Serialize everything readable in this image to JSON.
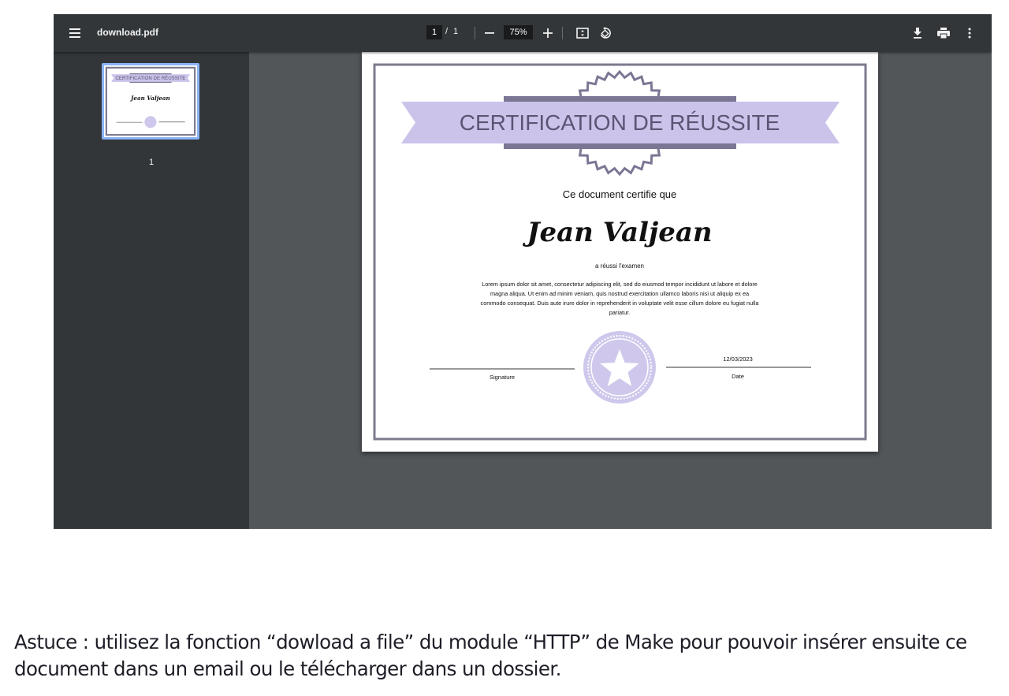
{
  "viewer": {
    "file_name": "download.pdf",
    "current_page": "1",
    "page_separator": "/",
    "total_pages": "1",
    "zoom": "75%",
    "thumbnail_label": "1",
    "icons": {
      "menu": "menu-icon",
      "zoom_out": "minus-icon",
      "zoom_in": "plus-icon",
      "fit": "fit-to-page-icon",
      "rotate": "rotate-icon",
      "download": "download-icon",
      "print": "print-icon",
      "more": "more-vert-icon"
    }
  },
  "certificate": {
    "title": "CERTIFICATION DE RÉUSSITE",
    "intro": "Ce document certifie que",
    "recipient": "Jean Valjean",
    "achievement": "a réussi l'examen",
    "body": [
      "Lorem ipsum dolor sit amet, consectetur adipiscing elit, sed do eiusmod tempor incididunt ut labore et dolore",
      "magna aliqua. Ut enim ad minim veniam, quis nostrud exercitation ullamco laboris nisi ut aliquip ex ea",
      "commodo consequat. Duis aute irure dolor in reprehenderit in voluptate velit esse cillum dolore eu fugiat nulla",
      "pariatur."
    ],
    "signature_label": "Signature",
    "date_value": "12/03/2023",
    "date_label": "Date",
    "colors": {
      "ribbon": "#cbc3ea",
      "ribbon_dark": "#7b7694",
      "border": "#7c7a8e",
      "seal": "#cfc8ec"
    }
  },
  "caption": {
    "line1": "Astuce : utilisez la fonction “dowload a file” du module “HTTP” de Make pour pouvoir insérer ensuite ce",
    "line2": "document dans un email ou le télécharger dans un dossier."
  }
}
